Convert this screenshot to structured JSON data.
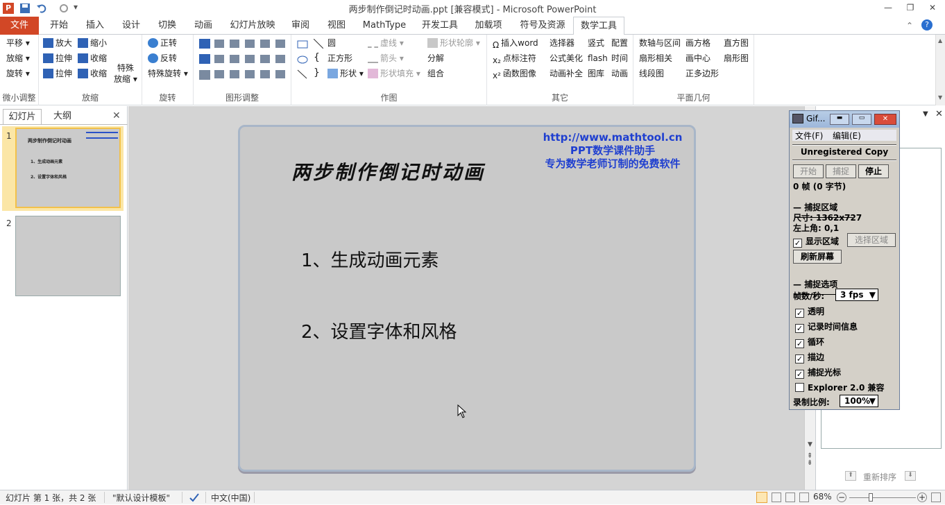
{
  "window": {
    "title": "两步制作倒记时动画.ppt [兼容模式] - Microsoft PowerPoint",
    "app_icon": "P",
    "min": "—",
    "restore": "❐",
    "close": "✕"
  },
  "tabs": [
    "文件",
    "开始",
    "插入",
    "设计",
    "切换",
    "动画",
    "幻灯片放映",
    "审阅",
    "视图",
    "MathType",
    "开发工具",
    "加载项",
    "符号及资源",
    "数学工具"
  ],
  "ribbon": {
    "g1": {
      "label": "微小调整",
      "items": [
        "平移",
        "放缩",
        "旋转"
      ]
    },
    "g2": {
      "label": "放缩",
      "items": [
        "放大",
        "缩小",
        "拉伸",
        "收缩",
        "拉伸",
        "收缩"
      ],
      "special": [
        "特殊",
        "放缩"
      ]
    },
    "g3": {
      "label": "旋转",
      "items": [
        "正转",
        "反转",
        "特殊旋转"
      ]
    },
    "g4": {
      "label": "图形调整"
    },
    "g5": {
      "label": "作图",
      "items": [
        "圆",
        "虚线",
        "形状轮廓",
        "正方形",
        "箭头",
        "分解",
        "形状",
        "形状填充",
        "组合"
      ]
    },
    "g6": {
      "label": "其它",
      "items": [
        "插入word",
        "选择器",
        "竖式",
        "配置",
        "点标注符",
        "公式美化",
        "flash",
        "时间",
        "函数图像",
        "动画补全",
        "图库",
        "动画"
      ]
    },
    "g7": {
      "label": "平面几何",
      "items": [
        "数轴与区间",
        "画方格",
        "直方图",
        "扇形相关",
        "画中心",
        "扇形图",
        "线段图",
        "正多边形"
      ]
    }
  },
  "left_panel": {
    "tab1": "幻灯片",
    "tab2": "大纲",
    "close": "✕",
    "slide1": "1",
    "slide2": "2",
    "thumb_title": "两步制作倒记时动画",
    "thumb_line1": "1、生成动画元素",
    "thumb_line2": "2、设置字体和风格"
  },
  "slide": {
    "url": "http://www.mathtool.cn",
    "sub1": "PPT数学课件助手",
    "sub2": "专为数学老师订制的免费软件",
    "title": "两步制作倒记时动画",
    "item1": "1、生成动画元素",
    "item2": "2、设置字体和风格"
  },
  "gif": {
    "title": "Gif...",
    "menu_file": "文件(F)",
    "menu_edit": "编辑(E)",
    "unreg": "Unregistered Copy",
    "btn_start": "开始",
    "btn_capture": "捕捉",
    "btn_stop": "停止",
    "frames": "0 帧 (0 字节)",
    "sec_area": "捕捉区域",
    "size": "尺寸: 1362x727",
    "corner": "左上角: 0,1",
    "show_area": "显示区域",
    "select_area": "选择区域",
    "refresh": "刷新屏幕",
    "sec_opts": "捕捉选项",
    "fps_label": "帧数/秒:",
    "fps_value": "3 fps",
    "opt1": "透明",
    "opt2": "记录时间信息",
    "opt3": "循环",
    "opt4": "描边",
    "opt5": "捕捉光标",
    "opt6": "Explorer 2.0 兼容",
    "scale_label": "录制比例:",
    "scale_value": "100%"
  },
  "right_panel": {
    "reorder": "重新排序"
  },
  "status": {
    "slide": "幻灯片 第 1 张，共 2 张",
    "theme": "\"默认设计模板\"",
    "lang": "中文(中国)",
    "zoom": "68%"
  }
}
